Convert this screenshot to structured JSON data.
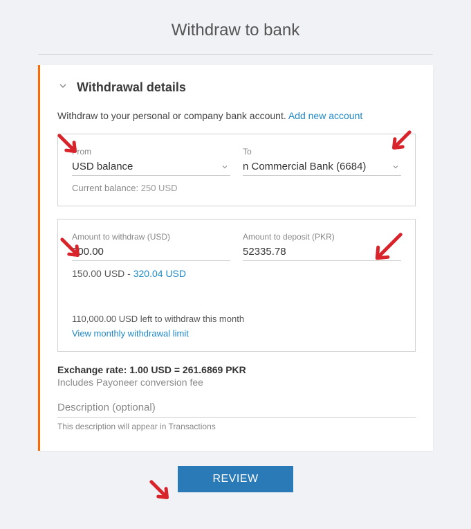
{
  "page_title": "Withdraw to bank",
  "section": {
    "title": "Withdrawal details",
    "intro_text": "Withdraw to your personal or company bank account. ",
    "add_account_link": "Add new account"
  },
  "from": {
    "label": "From",
    "value": "USD balance",
    "balance_label": "Current balance:",
    "balance_value": "250 USD"
  },
  "to": {
    "label": "To",
    "value": "n Commercial Bank (6684)"
  },
  "amount": {
    "withdraw_label": "Amount to withdraw (USD)",
    "withdraw_value": "200.00",
    "deposit_label": "Amount to deposit (PKR)",
    "deposit_value": "52335.78",
    "range_min": "150.00 USD",
    "range_sep": " - ",
    "range_max": "320.04 USD",
    "remaining": "110,000.00 USD left to withdraw this month",
    "view_limit": "View monthly withdrawal limit"
  },
  "exchange": {
    "rate_text": "Exchange rate: 1.00 USD = 261.6869 PKR",
    "fee_text": "Includes Payoneer conversion fee"
  },
  "description": {
    "placeholder": "Description (optional)",
    "hint": "This description will appear in Transactions"
  },
  "review_button": "REVIEW"
}
